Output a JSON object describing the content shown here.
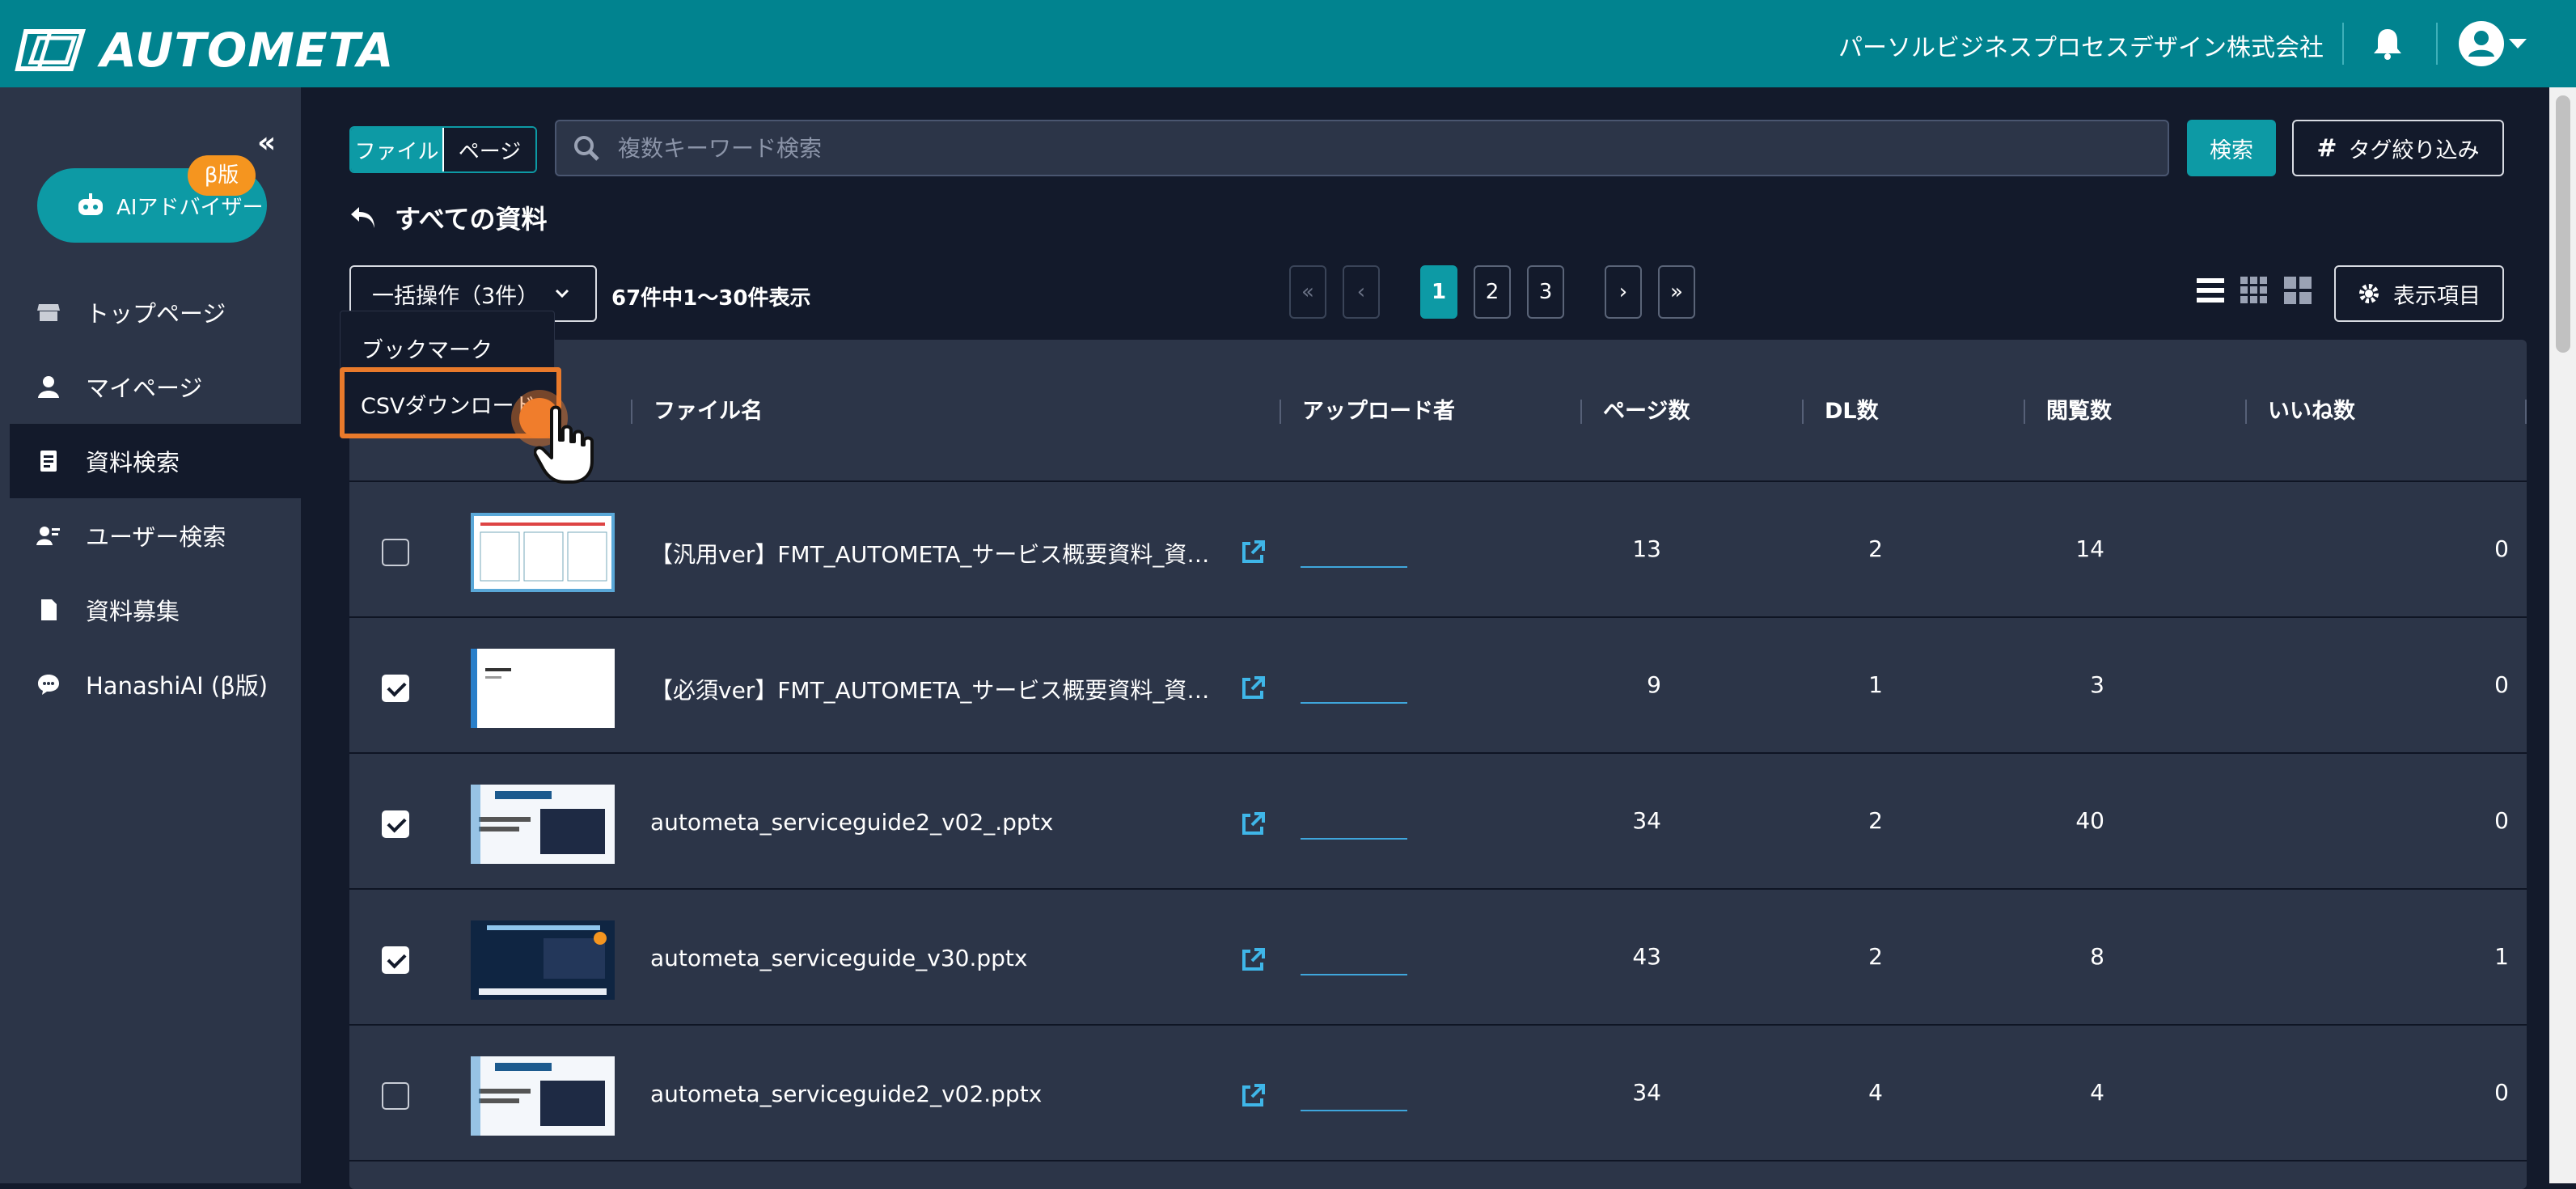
{
  "header": {
    "logo_text": "AUTOMETA",
    "company": "パーソルビジネスプロセスデザイン株式会社"
  },
  "sidebar": {
    "collapse_glyph": "«",
    "ai_button": {
      "label": "AIアドバイザー",
      "badge": "β版"
    },
    "items": [
      {
        "label": "トップページ",
        "icon": "store-icon"
      },
      {
        "label": "マイページ",
        "icon": "user-icon"
      },
      {
        "label": "資料検索",
        "icon": "document-search-icon",
        "active": true
      },
      {
        "label": "ユーザー検索",
        "icon": "user-search-icon"
      },
      {
        "label": "資料募集",
        "icon": "file-icon"
      },
      {
        "label": "HanashiAI (β版)",
        "icon": "chat-icon"
      }
    ]
  },
  "search": {
    "toggle": {
      "file": "ファイル",
      "page": "ページ"
    },
    "placeholder": "複数キーワード検索",
    "search_button": "検索",
    "tag_button": "タグ絞り込み"
  },
  "breadcrumb": {
    "title": "すべての資料"
  },
  "toolbar": {
    "bulk_label": "一括操作（3件）",
    "result_count": "67件中1〜30件表示",
    "pages": [
      "1",
      "2",
      "3"
    ],
    "current_page": "1",
    "pager_glyphs": {
      "first": "«",
      "prev": "‹",
      "next": "›",
      "last": "»"
    },
    "display_button": "表示項目"
  },
  "bulk_menu": {
    "items": [
      "ブックマーク",
      "CSVダウンロード"
    ],
    "highlighted": "CSVダウンロード"
  },
  "table": {
    "columns": [
      "ファイル名",
      "アップロード者",
      "ページ数",
      "DL数",
      "閲覧数",
      "いいね数"
    ],
    "rows": [
      {
        "checked": false,
        "name": "【汎用ver】FMT_AUTOMETA_サービス概要資料_資料作成…",
        "pages": "13",
        "dl": "2",
        "views": "14",
        "likes": "0"
      },
      {
        "checked": true,
        "name": "【必須ver】FMT_AUTOMETA_サービス概要資料_資料作成…",
        "pages": "9",
        "dl": "1",
        "views": "3",
        "likes": "0"
      },
      {
        "checked": true,
        "name": "autometa_serviceguide2_v02_.pptx",
        "pages": "34",
        "dl": "2",
        "views": "40",
        "likes": "0"
      },
      {
        "checked": true,
        "name": "autometa_serviceguide_v30.pptx",
        "pages": "43",
        "dl": "2",
        "views": "8",
        "likes": "1"
      },
      {
        "checked": false,
        "name": "autometa_serviceguide2_v02.pptx",
        "pages": "34",
        "dl": "4",
        "views": "4",
        "likes": "0"
      }
    ]
  },
  "colors": {
    "header": "#01838f",
    "accent": "#0d9aa5",
    "highlight": "#e97a2b",
    "bg": "#131a2b",
    "panel": "#2c3548"
  }
}
